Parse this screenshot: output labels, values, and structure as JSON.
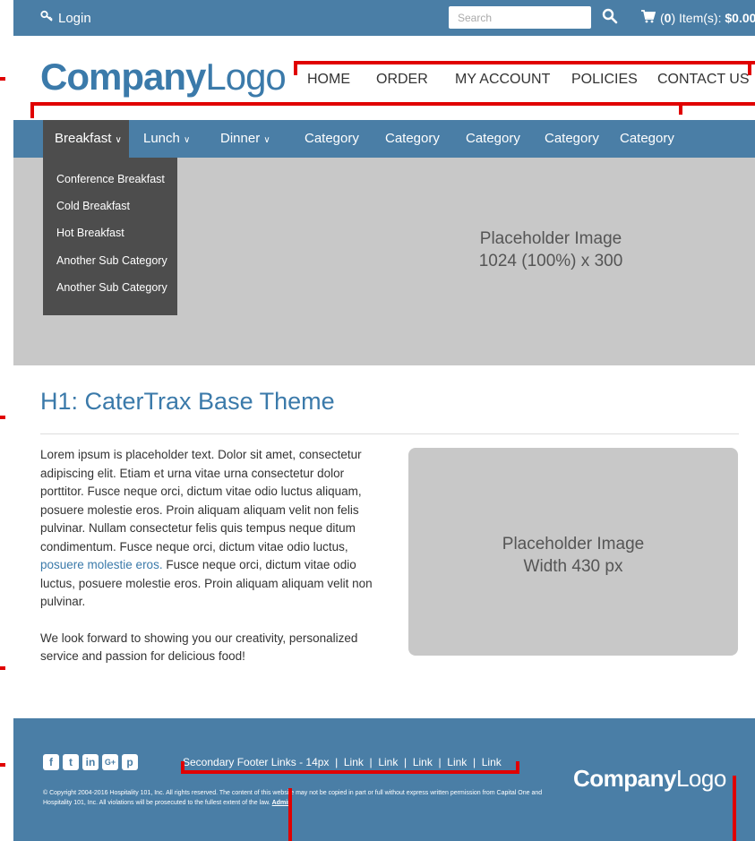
{
  "topbar": {
    "login_label": "Login",
    "search_placeholder": "Search",
    "cart_count": "0",
    "cart_items_label": "Item(s):",
    "cart_total": "$0.00"
  },
  "header": {
    "logo_part1": "Company",
    "logo_part2": "Logo",
    "nav": [
      "HOME",
      "ORDER",
      "MY ACCOUNT",
      "POLICIES",
      "CONTACT US"
    ]
  },
  "categories": [
    "Breakfast",
    "Lunch",
    "Dinner",
    "Category",
    "Category",
    "Category",
    "Category",
    "Category"
  ],
  "dropdown": {
    "items": [
      "Conference Breakfast",
      "Cold Breakfast",
      "Hot Breakfast",
      "Another Sub Category",
      "Another Sub Category"
    ]
  },
  "hero": {
    "line1": "Placeholder Image",
    "line2": "1024 (100%) x 300"
  },
  "content": {
    "heading": "H1: CaterTrax Base Theme",
    "para1_a": "Lorem ipsum is placeholder text. Dolor sit amet, consectetur adipiscing elit. Etiam et urna vitae urna consectetur dolor porttitor. Fusce neque orci, dictum vitae odio luctus aliquam, posuere molestie eros. Proin aliquam aliquam velit non felis pulvinar. Nullam consectetur felis quis tempus neque ditum condimentum. Fusce neque orci, dictum vitae odio luctus,",
    "para1_link": "posuere molestie eros.",
    "para1_b": "Fusce neque orci, dictum vitae odio luctus, posuere molestie eros. Proin aliquam aliquam velit non pulvinar.",
    "para2": "We look forward to showing you our creativity, personalized service and passion for delicious food!",
    "image_line1": "Placeholder Image",
    "image_line2": "Width 430 px"
  },
  "footer": {
    "social_icons": [
      "facebook-icon",
      "twitter-icon",
      "linkedin-icon",
      "google-plus-icon",
      "pinterest-icon"
    ],
    "secondary_label": "Secondary Footer Links - 14px",
    "links": [
      "Link",
      "Link",
      "Link",
      "Link",
      "Link"
    ],
    "copyright": "© Copyright 2004-2016 Hospitality 101, Inc. All rights reserved. The content of this website may not be copied in part or full without express written permission from Capital One and Hospitality 101, Inc. All violations will be prosecuted to the fullest extent of the law.",
    "admin_link": "Admin",
    "logo_part1": "Company",
    "logo_part2": "Logo"
  },
  "colors": {
    "brand_blue": "#4a7ea6",
    "logo_blue": "#3b7aaa",
    "dropdown_gray": "#4d4d4d",
    "placeholder_gray": "#c8c8c8",
    "annotation_red": "#e00000"
  }
}
